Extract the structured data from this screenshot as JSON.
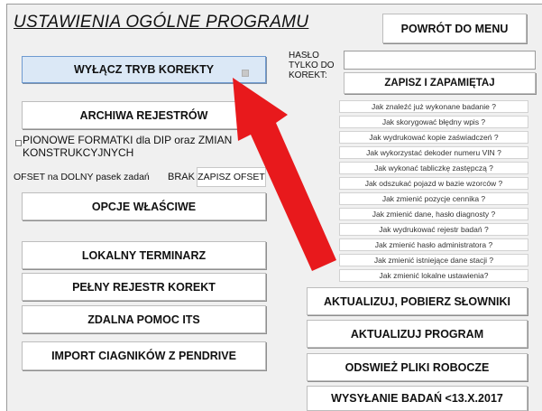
{
  "window": {
    "title": "USTAWIENIA OGÓLNE  PROGRAMU"
  },
  "header": {
    "back_label": "POWRÓT DO MENU"
  },
  "password": {
    "label_lines": [
      "HASŁO",
      "TYLKO DO",
      "KOREKT:"
    ],
    "value": "",
    "save_label": "ZAPISZ I ZAPAMIĘTAJ"
  },
  "left": {
    "disable_correction_label": "WYŁĄCZ TRYB KOREKTY",
    "archive_label": "ARCHIWA REJESTRÓW",
    "dip_checkbox_line1": "PIONOWE FORMATKI dla DIP oraz ZMIAN",
    "dip_checkbox_line2": "KONSTRUKCYJNYCH",
    "offset_label": "OFSET  na DOLNY pasek zadań",
    "offset_value": "BRAK",
    "offset_save_label": "ZAPISZ OFSET",
    "own_options_label": "OPCJE WŁAŚCIWE",
    "local_scheduler_label": "LOKALNY  TERMINARZ",
    "full_register_label": "PEŁNY REJESTR KOREKT",
    "remote_help_label": "ZDALNA  POMOC  ITS",
    "import_tractors_label": "IMPORT CIAGNIKÓW Z PENDRIVE"
  },
  "help_links": [
    "Jak znaleźć już wykonane badanie ?",
    "Jak skorygować błędny wpis ?",
    "Jak wydrukować kopie zaświadczeń ?",
    "Jak wykorzystać dekoder numeru VIN ?",
    "Jak wykonać tabliczkę zastępczą ?",
    "Jak odszukać pojazd w bazie wzorców ?",
    "Jak zmienić pozycje cennika ?",
    "Jak zmienić dane, hasło diagnosty ?",
    "Jak wydrukować rejestr badań ?",
    "Jak zmienić hasło administratora ?",
    "Jak zmienić istniejące dane stacji ?",
    "Jak zmienić lokalne ustawienia?"
  ],
  "right": {
    "update_dicts_label": "AKTUALIZUJ, POBIERZ SŁOWNIKI",
    "update_program_label": "AKTUALIZUJ  PROGRAM",
    "refresh_files_label": "ODSWIEŻ  PLIKI  ROBOCZE",
    "send_tests_label": "WYSYŁANIE  BADAŃ <13.X.2017"
  },
  "annotation": {
    "arrow_color": "#e8191c"
  }
}
